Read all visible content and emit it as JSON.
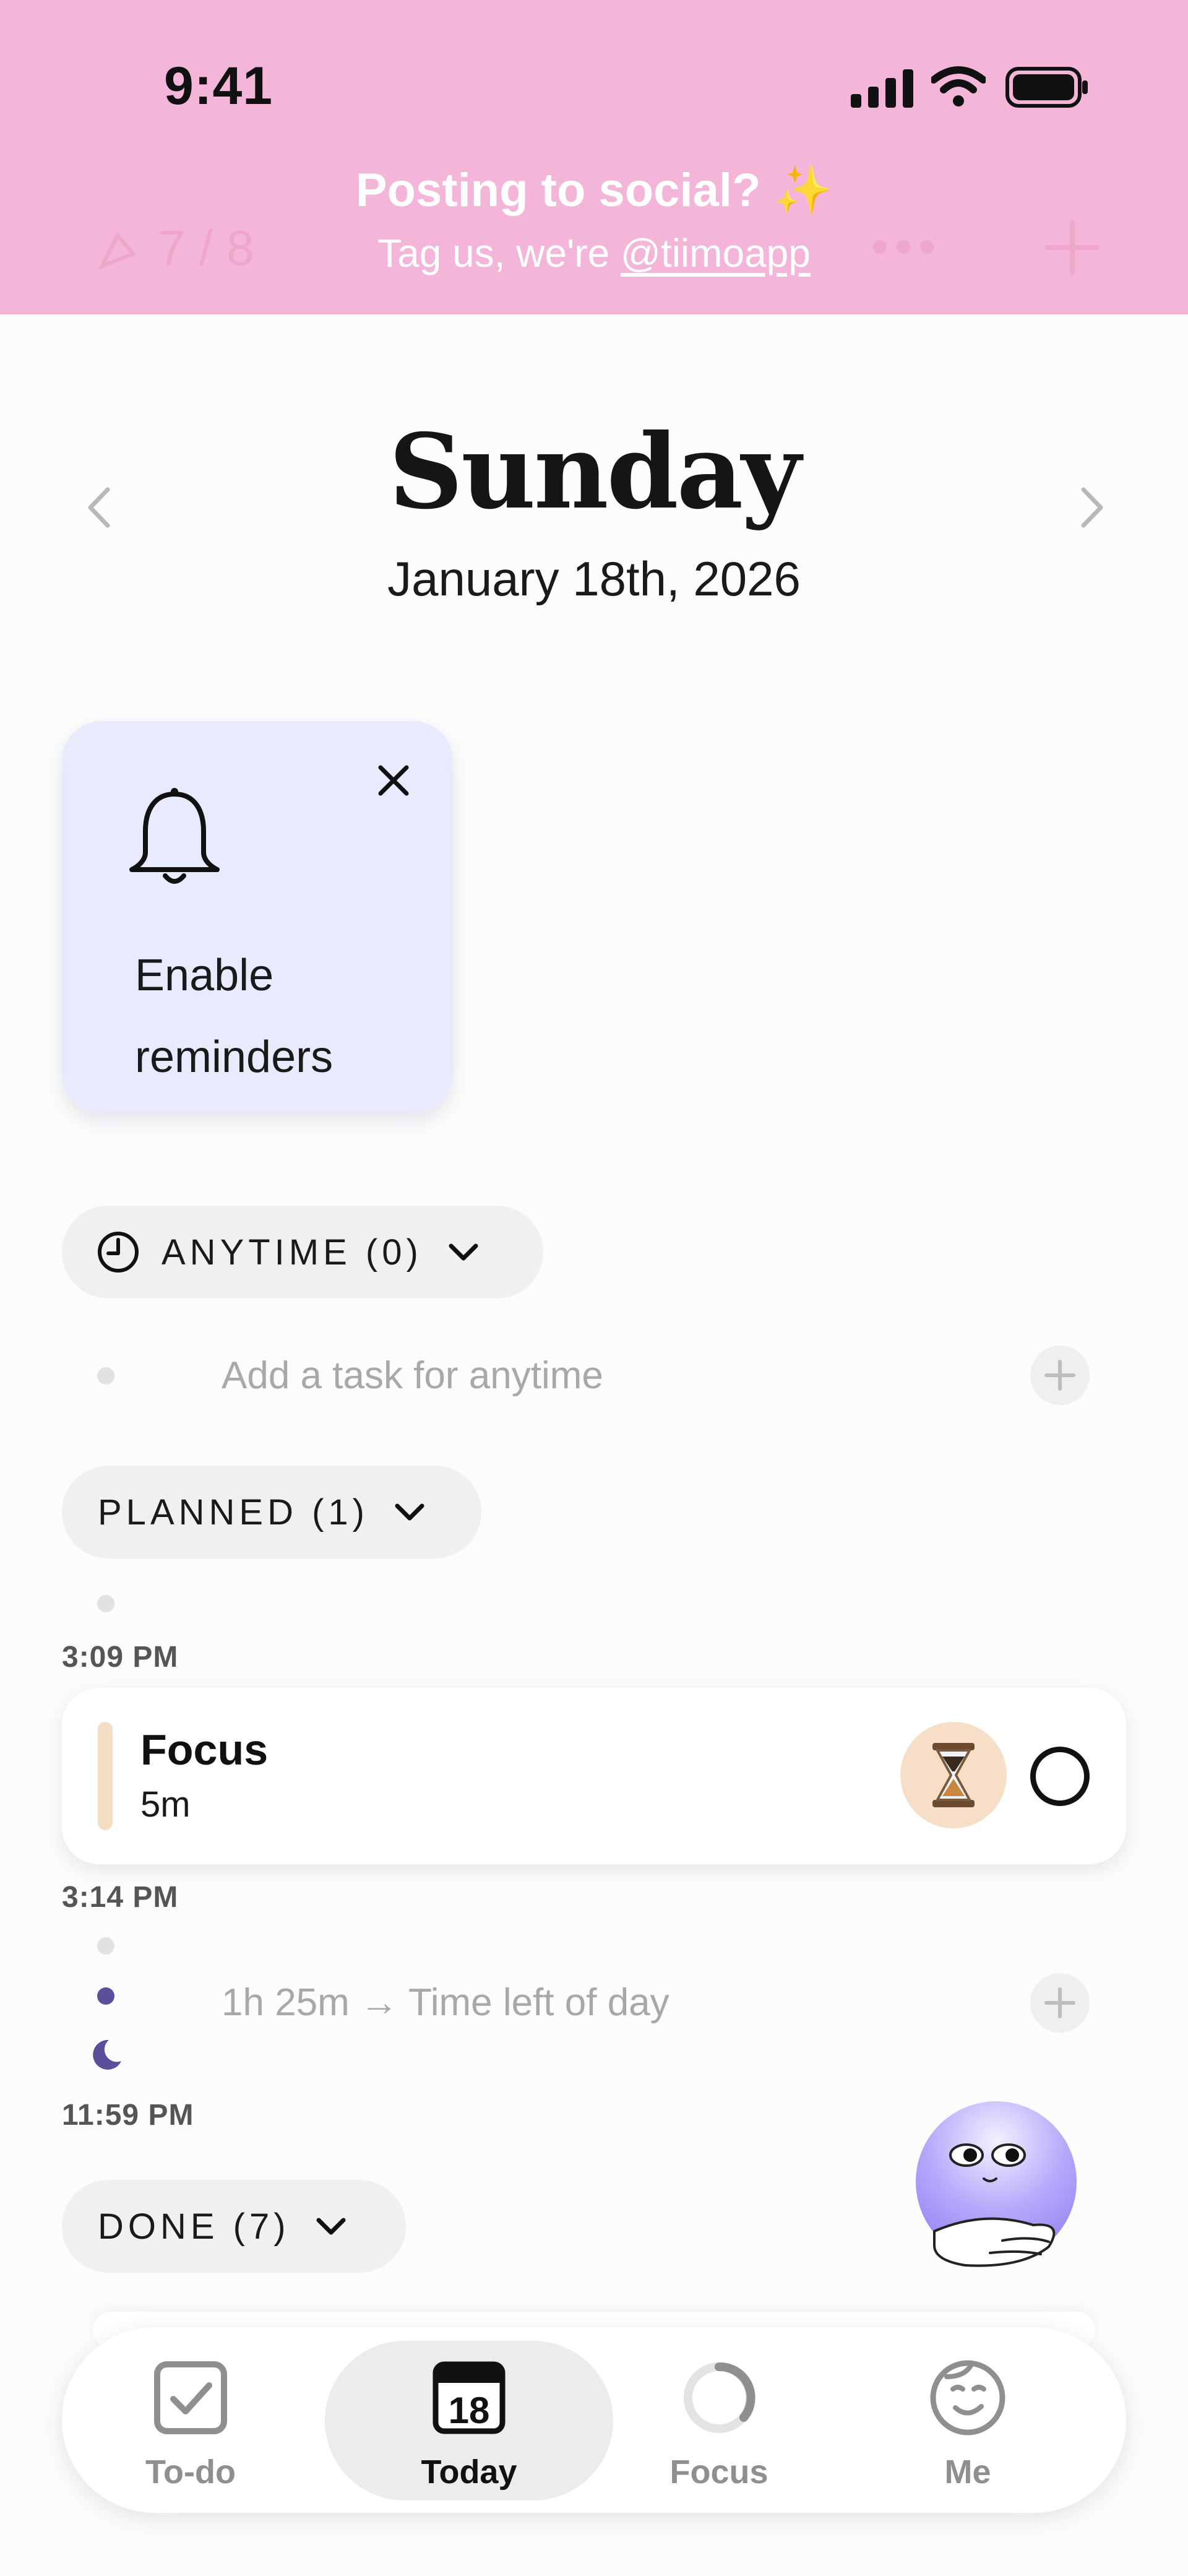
{
  "status_bar": {
    "time": "9:41"
  },
  "banner": {
    "title": "Posting to social? ✨",
    "subtitle_prefix": "Tag us, we're ",
    "handle": "@tiimoapp",
    "behind_progress": "7 / 8"
  },
  "day": {
    "weekday": "Sunday",
    "date": "January 18th, 2026"
  },
  "reminder_card": {
    "label_line1": "Enable",
    "label_line2": "reminders"
  },
  "sections": {
    "anytime": {
      "label": "ANYTIME (0)",
      "add_placeholder": "Add a task for anytime"
    },
    "planned": {
      "label": "PLANNED (1)"
    },
    "done": {
      "label": "DONE (7)"
    }
  },
  "timeline": {
    "start_time": "3:09 PM",
    "end_time": "3:14 PM",
    "time_left": "1h 25m → Time left of day",
    "day_end": "11:59 PM"
  },
  "task": {
    "title": "Focus",
    "duration": "5m",
    "icon": "hourglass-icon",
    "accent_color": "#f3dfc4"
  },
  "tabbar": {
    "tabs": [
      {
        "label": "To-do",
        "icon": "checkbox-icon"
      },
      {
        "label": "Today",
        "icon": "calendar-icon",
        "day_number": "18",
        "active": true
      },
      {
        "label": "Focus",
        "icon": "focus-ring-icon"
      },
      {
        "label": "Me",
        "icon": "face-icon"
      }
    ]
  },
  "colors": {
    "banner": "#f3b6d8",
    "reminder_card": "#e8eafe",
    "pill": "#f1f0ee",
    "mascot": "#9b8cf6"
  }
}
